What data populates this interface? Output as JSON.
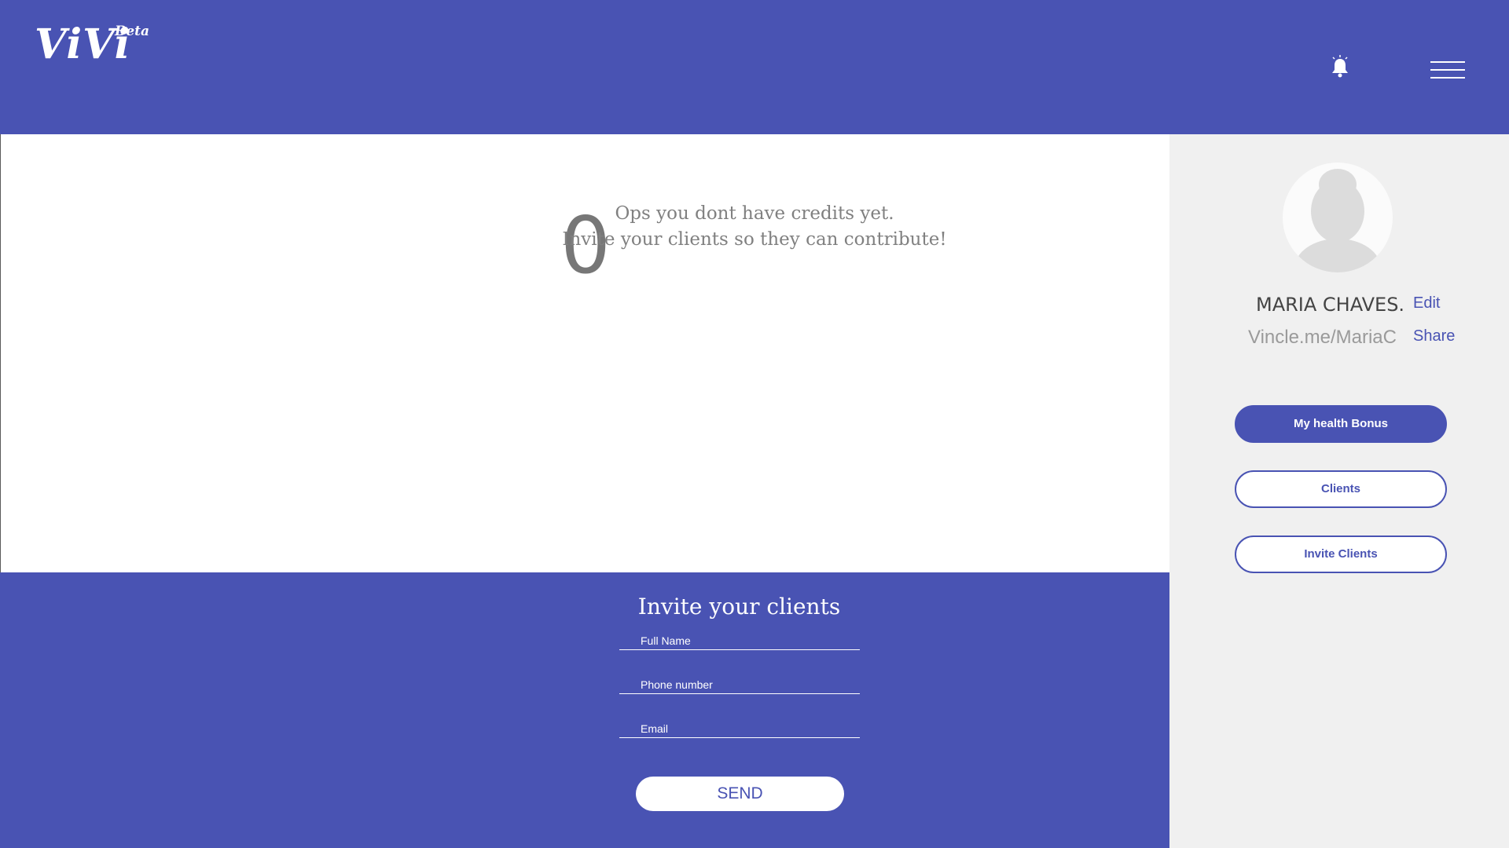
{
  "header": {
    "logo": "ViVi",
    "beta": "Beta",
    "bell_icon": "bell-icon",
    "menu_icon": "hamburger-menu-icon"
  },
  "credits": {
    "count": "0",
    "message_line1": "Ops you dont have credits yet.",
    "message_line2": "Invite your clients so they can contribute!"
  },
  "invite": {
    "title": "Invite your clients",
    "full_name_placeholder": "Full Name",
    "phone_placeholder": "Phone number",
    "email_placeholder": "Email",
    "send_label": "SEND"
  },
  "profile": {
    "name": "MARIA CHAVES.",
    "edit_label": "Edit",
    "link": "Vincle.me/MariaC",
    "share_label": "Share",
    "avatar_icon": "user-avatar-icon"
  },
  "sidebar": {
    "buttons": [
      {
        "label": "My health Bonus",
        "active": true
      },
      {
        "label": "Clients",
        "active": false
      },
      {
        "label": "Invite Clients",
        "active": false
      }
    ]
  },
  "colors": {
    "brand": "#4953b3",
    "sidebar_bg": "#f0f0f0",
    "text_gray": "#808080"
  }
}
